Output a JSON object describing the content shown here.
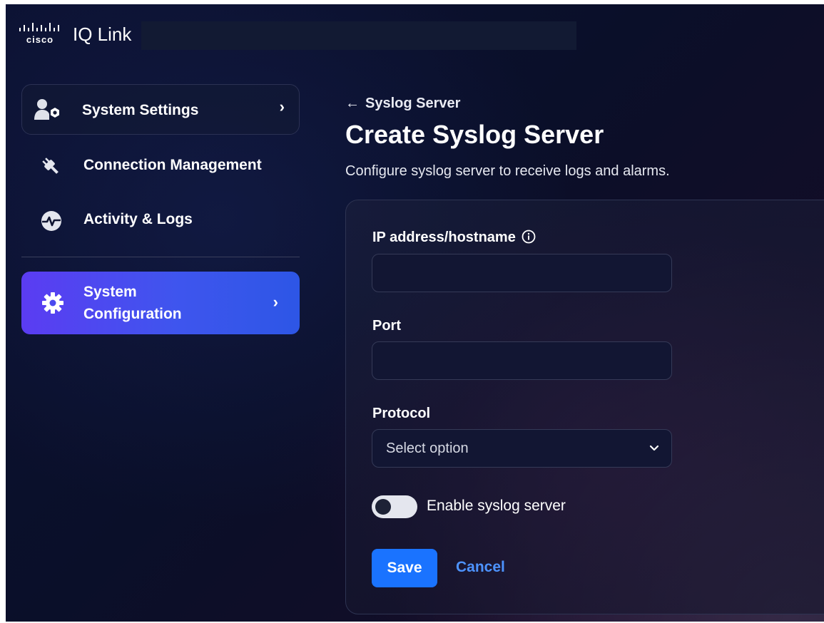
{
  "header": {
    "logo_text": "cisco",
    "app_name": "IQ Link"
  },
  "sidebar": {
    "items": [
      {
        "label": "System Settings",
        "icon": "user-gear-icon",
        "chevron": "›"
      },
      {
        "label": "Connection Management",
        "icon": "plug-icon"
      },
      {
        "label": "Activity & Logs",
        "icon": "activity-pulse-icon"
      },
      {
        "label_line1": "System",
        "label_line2": "Configuration",
        "icon": "gear-icon",
        "chevron": "›"
      }
    ]
  },
  "main": {
    "back_arrow": "←",
    "back_label": "Syslog Server",
    "title": "Create Syslog Server",
    "subtitle": "Configure syslog server to receive logs and alarms."
  },
  "form": {
    "ip_label": "IP address/hostname",
    "ip_value": "",
    "port_label": "Port",
    "port_value": "",
    "protocol_label": "Protocol",
    "protocol_selected": "Select option",
    "toggle_label": "Enable syslog server",
    "toggle_on": false,
    "save_label": "Save",
    "cancel_label": "Cancel"
  },
  "colors": {
    "accent_blue": "#1a73ff",
    "link_blue": "#4d93ff",
    "active_nav_start": "#5b3cf2",
    "active_nav_end": "#2d56e6"
  }
}
